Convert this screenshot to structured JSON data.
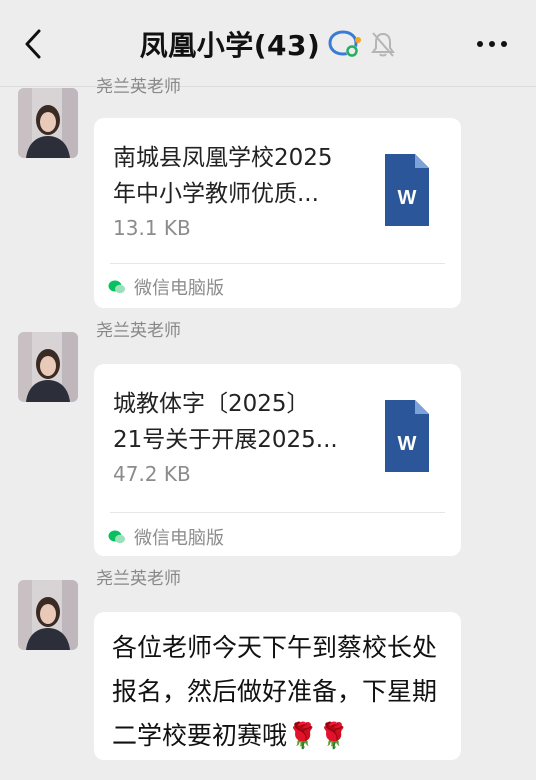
{
  "header": {
    "title": "凤凰小学(43)",
    "back_icon": "chevron-left-icon",
    "more_icon": "more-horizontal-icon",
    "group_icon": "group-chat-icon",
    "mute_icon": "bell-muted-icon"
  },
  "messages": [
    {
      "sender": "尧兰英老师",
      "file_name": "南城县凤凰学校2025\n年中小学教师优质...",
      "file_size": "13.1 KB",
      "file_icon": "word-document-icon",
      "source": "微信电脑版"
    },
    {
      "sender": "尧兰英老师",
      "file_name": "城教体字〔2025〕\n21号关于开展2025...",
      "file_size": "47.2 KB",
      "file_icon": "word-document-icon",
      "source": "微信电脑版"
    },
    {
      "sender": "尧兰英老师",
      "text": "各位老师今天下午到蔡校长处报名，然后做好准备，下星期二学校要初赛哦🌹🌹"
    }
  ],
  "colors": {
    "background": "#ededed",
    "bubble": "#ffffff",
    "word_blue": "#2b579a",
    "wechat_green": "#07c160"
  }
}
